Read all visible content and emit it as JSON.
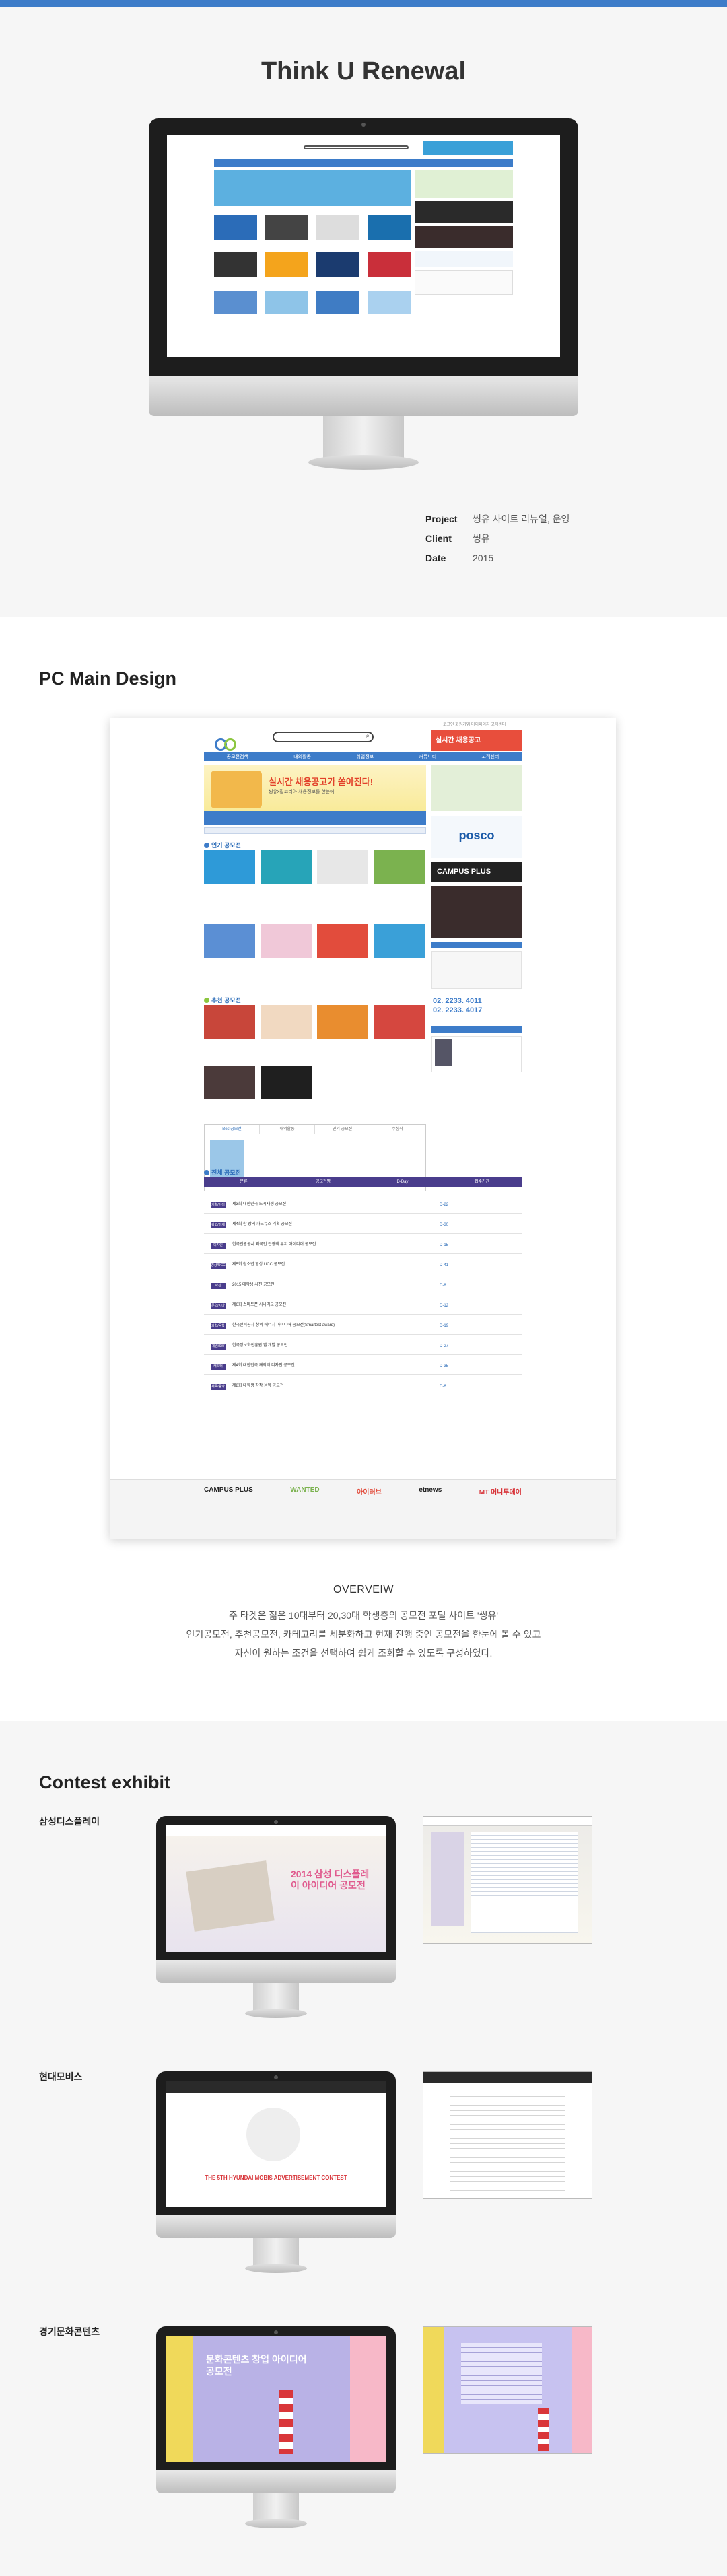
{
  "hero": {
    "title": "Think U Renewal"
  },
  "project_meta": [
    {
      "key": "Project",
      "value": "씽유 사이트 리뉴얼, 운영"
    },
    {
      "key": "Client",
      "value": "씽유"
    },
    {
      "key": "Date",
      "value": "2015"
    }
  ],
  "sections": {
    "pc_main": "PC Main Design",
    "contest": "Contest exhibit"
  },
  "pc_site": {
    "nav": [
      "공모전검색",
      "대외활동",
      "취업정보",
      "커뮤니티",
      "고객센터"
    ],
    "top_links": "로그인  회원가입  마이페이지  고객센터",
    "ad_top": "실시간 채용공고",
    "banner_title": "실시간 채용공고가 쏟아진다!",
    "banner_sub": "씽유x잡코리아 채용정보를 한눈에",
    "section_popular": "인기 공모전",
    "section_recommend": "추천 공모전",
    "section_all": "전체 공모전",
    "side_campus": "CAMPUS PLUS",
    "side_posco": "posco",
    "side_phone1": "02. 2233. 4011",
    "side_phone2": "02. 2233. 4017",
    "tabs": [
      "Best공모전",
      "대외활동",
      "인기 공모전",
      "수상작"
    ],
    "table_headers": [
      "분류",
      "공모전명",
      "D-Day",
      "접수기간"
    ],
    "rows": [
      {
        "tag": "기획/아이디어",
        "title": "제3회 대한민국 도시재생 공모전",
        "dday": "D-22"
      },
      {
        "tag": "광고/마케팅",
        "title": "제4회 한 장의 카드뉴스 기획 공모전",
        "dday": "D-30"
      },
      {
        "tag": "디자인",
        "title": "한국관광공사 외국인 관광객 유치 아이디어 공모전",
        "dday": "D-15"
      },
      {
        "tag": "영상/UCC",
        "title": "제5회 청소년 영상 UCC 공모전",
        "dday": "D-41"
      },
      {
        "tag": "사진",
        "title": "2015 대학생 사진 공모전",
        "dday": "D-8"
      },
      {
        "tag": "문학/시나리오",
        "title": "제6회 스마트폰 시나리오 공모전",
        "dday": "D-12"
      },
      {
        "tag": "과학/공학",
        "title": "한국전력공사 창의 에너지 아이디어 공모전(Smartest award)",
        "dday": "D-19"
      },
      {
        "tag": "게임/SW",
        "title": "한국정보화진흥원 앱 개발 공모전",
        "dday": "D-27"
      },
      {
        "tag": "캐릭터",
        "title": "제4회 대한민국 캐릭터 디자인 공모전",
        "dday": "D-35"
      },
      {
        "tag": "체육/음악",
        "title": "제8회 대학생 창작 음악 공모전",
        "dday": "D-6"
      }
    ],
    "partners": [
      "CAMPUS PLUS",
      "WANTED",
      "아이러브",
      "etnews",
      "MT 머니투데이"
    ]
  },
  "overview": {
    "title": "OVERVEIW",
    "lines": [
      "주 타겟은 젊은 10대부터 20,30대 학생층의 공모전 포털 사이트 '씽유'",
      "인기공모전, 추천공모전, 카테고리를 세분화하고 현재 진행 중인 공모전을 한눈에 볼 수 있고",
      "자신이 원하는 조건을 선택하여 쉽게 조회할 수 있도록 구성하였다."
    ]
  },
  "exhibits": [
    {
      "label": "삼성디스플레이",
      "screen_text": "2014 삼성 디스플레이 아이디어 공모전"
    },
    {
      "label": "현대모비스",
      "screen_text": "THE 5TH HYUNDAI MOBIS ADVERTISEMENT CONTEST"
    },
    {
      "label": "경기문화콘텐츠",
      "screen_text": "문화콘텐츠 창업 아이디어 공모전"
    }
  ],
  "colors": {
    "accent": "#3d7cc9",
    "purple": "#4a3d8c",
    "green": "#8cc63f"
  }
}
